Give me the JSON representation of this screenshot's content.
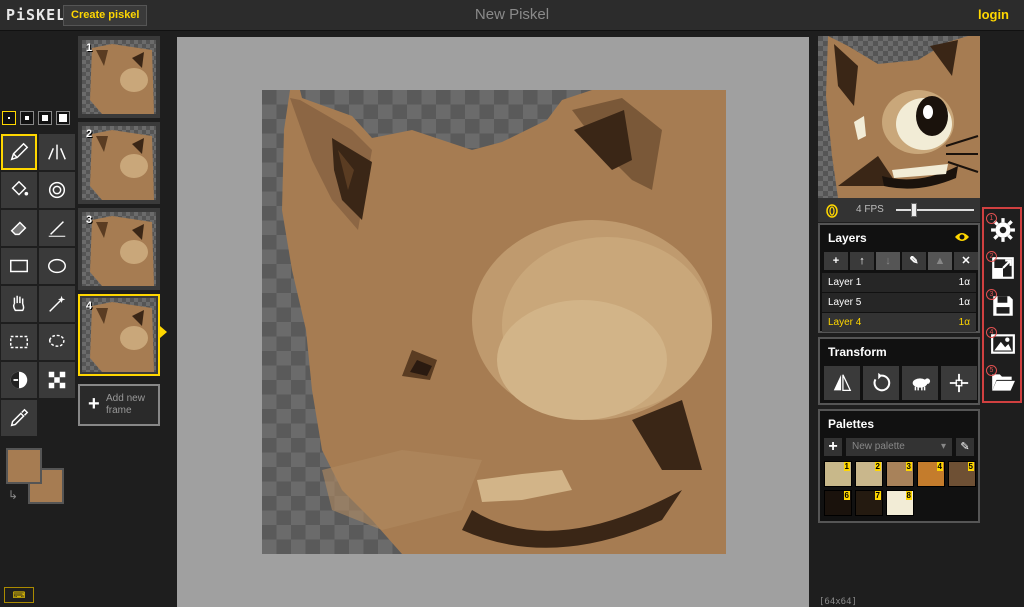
{
  "app": {
    "logo": "PiSKEL",
    "create_label": "Create piskel",
    "title": "New Piskel",
    "login_label": "login"
  },
  "tools": [
    {
      "name": "pen-tool",
      "icon": "pencil-icon",
      "selected": true
    },
    {
      "name": "vertical-mirror-pen-tool",
      "icon": "mirror-pen-icon"
    },
    {
      "name": "paint-bucket-tool",
      "icon": "bucket-icon"
    },
    {
      "name": "paint-all-same-color-tool",
      "icon": "spiral-bucket-icon"
    },
    {
      "name": "eraser-tool",
      "icon": "eraser-icon"
    },
    {
      "name": "stroke-tool",
      "icon": "line-pen-icon"
    },
    {
      "name": "rectangle-tool",
      "icon": "rectangle-icon"
    },
    {
      "name": "circle-tool",
      "icon": "circle-icon"
    },
    {
      "name": "move-tool",
      "icon": "hand-icon"
    },
    {
      "name": "shape-selection-tool",
      "icon": "magic-wand-icon"
    },
    {
      "name": "rectangle-selection-tool",
      "icon": "dashed-rect-icon"
    },
    {
      "name": "lasso-selection-tool",
      "icon": "lasso-icon"
    },
    {
      "name": "lighten-tool",
      "icon": "lighten-icon"
    },
    {
      "name": "dithering-tool",
      "icon": "checker-icon"
    },
    {
      "name": "color-picker-tool",
      "icon": "eyedropper-icon"
    }
  ],
  "colors": {
    "primary": "#a67c52",
    "secondary": "#a67c52",
    "accent": "#ffd700"
  },
  "frames": [
    {
      "number": "1"
    },
    {
      "number": "2"
    },
    {
      "number": "3"
    },
    {
      "number": "4",
      "selected": true
    }
  ],
  "add_frame_label": "Add new frame",
  "preview": {
    "fps_label": "4 FPS",
    "fps": 4
  },
  "layers": {
    "title": "Layers",
    "buttons": [
      "+",
      "↑",
      "↓",
      "✎",
      "▲",
      "✕"
    ],
    "items": [
      {
        "name": "Layer 1",
        "alpha": "1α"
      },
      {
        "name": "Layer 5",
        "alpha": "1α"
      },
      {
        "name": "Layer 4",
        "alpha": "1α",
        "selected": true
      }
    ]
  },
  "transform": {
    "title": "Transform"
  },
  "palettes": {
    "title": "Palettes",
    "select_value": "New palette",
    "swatches": [
      {
        "n": "1",
        "color": "#c8b88a"
      },
      {
        "n": "2",
        "color": "#c9b78c"
      },
      {
        "n": "3",
        "color": "#a8825a"
      },
      {
        "n": "4",
        "color": "#c47c2c"
      },
      {
        "n": "5",
        "color": "#6e5034"
      },
      {
        "n": "6",
        "color": "#1a120c"
      },
      {
        "n": "7",
        "color": "#241a10"
      },
      {
        "n": "8",
        "color": "#f2ecd6"
      }
    ]
  },
  "settings": [
    {
      "badge": "1",
      "icon": "gear-icon"
    },
    {
      "badge": "2",
      "icon": "resize-icon"
    },
    {
      "badge": "3",
      "icon": "save-icon"
    },
    {
      "badge": "4",
      "icon": "image-export-icon"
    },
    {
      "badge": "5",
      "icon": "folder-open-icon"
    }
  ],
  "canvas_size_label": "[64x64]",
  "keyboard_shortcuts": "⌨"
}
